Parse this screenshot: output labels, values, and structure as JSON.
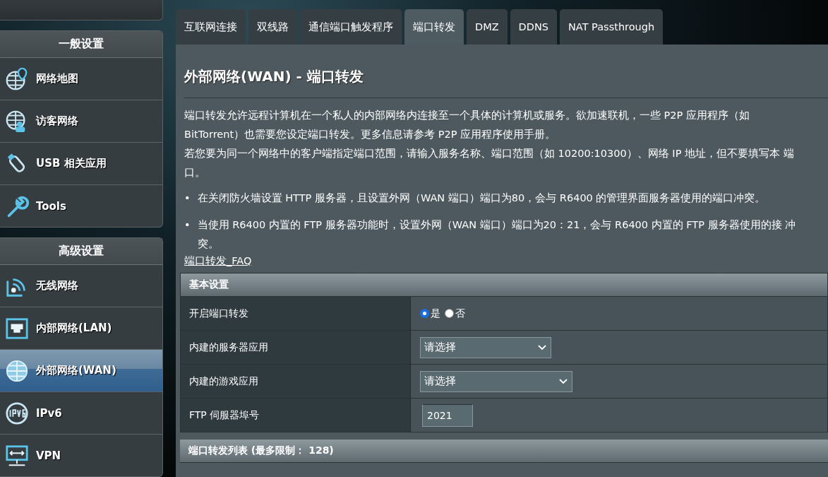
{
  "sidebar": {
    "sections": [
      {
        "title": "一般设置",
        "items": [
          {
            "label": "网络地图",
            "kind": "map",
            "selected": false
          },
          {
            "label": "访客网络",
            "kind": "guest",
            "selected": false
          },
          {
            "label": "USB 相关应用",
            "kind": "usb",
            "selected": false
          },
          {
            "label": "Tools",
            "kind": "wrench",
            "selected": false
          }
        ]
      },
      {
        "title": "高级设置",
        "items": [
          {
            "label": "无线网络",
            "kind": "wifi",
            "selected": false
          },
          {
            "label": "内部网络(LAN)",
            "kind": "lan",
            "selected": false
          },
          {
            "label": "外部网络(WAN)",
            "kind": "globe",
            "selected": true
          },
          {
            "label": "IPv6",
            "kind": "ipv6",
            "selected": false
          },
          {
            "label": "VPN",
            "kind": "vpn",
            "selected": false
          }
        ]
      }
    ]
  },
  "tabs": [
    {
      "label": "互联网连接",
      "selected": false
    },
    {
      "label": "双线路",
      "selected": false
    },
    {
      "label": "通信端口触发程序",
      "selected": false
    },
    {
      "label": "端口转发",
      "selected": true
    },
    {
      "label": "DMZ",
      "selected": false
    },
    {
      "label": "DDNS",
      "selected": false
    },
    {
      "label": "NAT Passthrough",
      "selected": false
    }
  ],
  "page_title": "外部网络(WAN) - 端口转发",
  "paragraphs": [
    "端口转发允许远程计算机在一个私人的内部网络内连接至一个具体的计算机或服务。欲加速联机，一些 P2P 应用程序（如 BitTorrent）也需要您设定端口转发。更多信息请参考 P2P 应用程序使用手册。",
    "若您要为同一个网络中的客户端指定端口范围，请输入服务名称、端口范围（如 10200:10300）、网络 IP 地址，但不要填写本 端口。"
  ],
  "bullets": [
    {
      "marker": "•",
      "text": "在关闭防火墙设置 HTTP 服务器，且设置外网（WAN 端口）端口为80，会与 R6400 的管理界面服务器使用的端口冲突。"
    },
    {
      "marker": "•",
      "text": "当使用 R6400 内置的 FTP 服务器功能时，设置外网（WAN 端口）端口为20：21，会与 R6400 内置的 FTP 服务器使用的接 冲突。"
    }
  ],
  "faq_link": "端口转发_FAQ",
  "basic_settings": {
    "title": "基本设置",
    "rows": [
      {
        "kind": "radio",
        "label": "开启端口转发",
        "options": [
          {
            "label": "是",
            "selected": true
          },
          {
            "label": "否",
            "selected": false
          }
        ]
      },
      {
        "kind": "select",
        "label": "内建的服务器应用",
        "value": "请选择"
      },
      {
        "kind": "select",
        "label": "内建的游戏应用",
        "value": "请选择"
      },
      {
        "kind": "input",
        "label": "FTP 伺服器埠号",
        "value": "2021"
      }
    ]
  },
  "list_section": {
    "title": "端口转发列表 (最多限制： 128)"
  }
}
